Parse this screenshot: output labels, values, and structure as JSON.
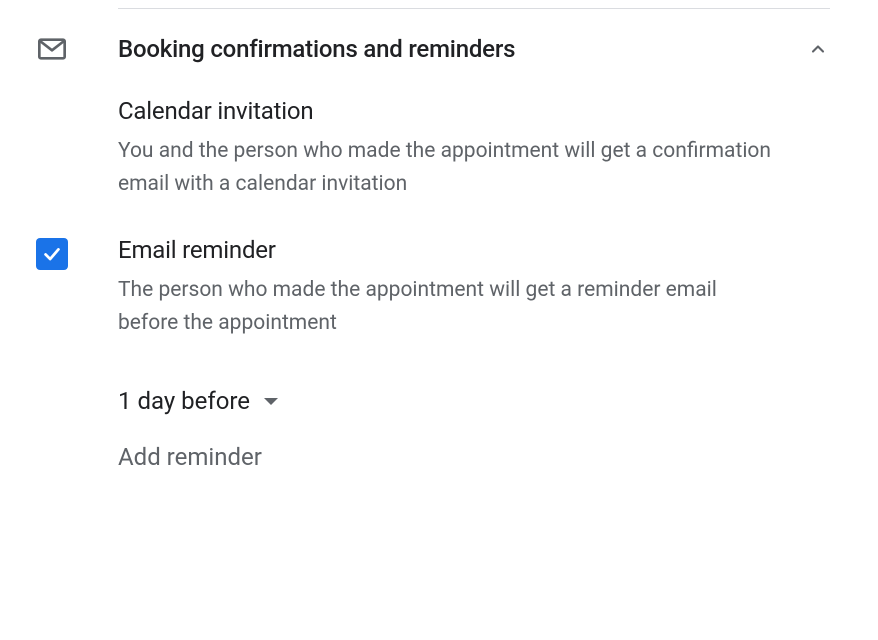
{
  "section": {
    "title": "Booking confirmations and reminders"
  },
  "calendar_invitation": {
    "title": "Calendar invitation",
    "description": "You and the person who made the appointment will get a confirmation email with a calendar invitation"
  },
  "email_reminder": {
    "title": "Email reminder",
    "description": "The person who made the appointment will get a reminder email before the appointment",
    "checked": true
  },
  "reminder_dropdown": {
    "selected": "1 day before"
  },
  "add_reminder": {
    "label": "Add reminder"
  }
}
